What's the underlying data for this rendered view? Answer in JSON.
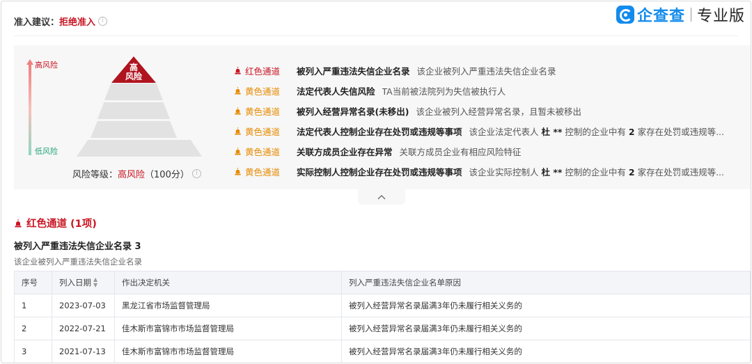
{
  "header": {
    "label": "准入建议：",
    "value": "拒绝准入"
  },
  "brand": {
    "name": "企查查",
    "edition": "专业版"
  },
  "risk_scale": {
    "high_label": "高风险",
    "low_label": "低风险"
  },
  "pyramid": {
    "top_line1": "高",
    "top_line2": "风险"
  },
  "risk_level": {
    "label": "风险等级：",
    "value": "高风险",
    "score": "（100分）"
  },
  "channels": [
    {
      "tag": "红色通道",
      "level": "red",
      "title": "被列入严重违法失信企业名录",
      "desc": "该企业被列入严重违法失信企业名录"
    },
    {
      "tag": "黄色通道",
      "level": "yellow",
      "title": "法定代表人失信风险",
      "desc": "TA当前被法院列为失信被执行人"
    },
    {
      "tag": "黄色通道",
      "level": "yellow",
      "title": "被列入经营异常名录(未移出)",
      "desc": "该企业被列入经营异常名录，且暂未被移出"
    },
    {
      "tag": "黄色通道",
      "level": "yellow",
      "title": "法定代表人控制企业存在处罚或违规等事项",
      "desc_pre": "该企业法定代表人 ",
      "desc_person": "杜 **",
      "desc_mid": " 控制的企业中有 ",
      "desc_count": "2",
      "desc_post": " 家存在处罚或违规等..."
    },
    {
      "tag": "黄色通道",
      "level": "yellow",
      "title": "关联方成员企业存在异常",
      "desc": "关联方成员企业有相应风险特征"
    },
    {
      "tag": "黄色通道",
      "level": "yellow",
      "title": "实际控制人控制企业存在处罚或违规等事项",
      "desc_pre": "该企业实际控制人 ",
      "desc_person": "杜 **",
      "desc_mid": " 控制的企业中有 ",
      "desc_count": "2",
      "desc_post": " 家存在处罚或违规等..."
    }
  ],
  "collapse_icon": "chevron-up-icon",
  "section": {
    "title": "红色通道 (1项)",
    "subtitle": "被列入严重违法失信企业名录 3",
    "description": "该企业被列入严重违法失信企业名录"
  },
  "table": {
    "headers": [
      "序号",
      "列入日期",
      "作出决定机关",
      "列入严重违法失信企业名单原因"
    ],
    "rows": [
      [
        "1",
        "2023-07-03",
        "黑龙江省市场监督管理局",
        "被列入经营异常名录届满3年仍未履行相关义务的"
      ],
      [
        "2",
        "2022-07-21",
        "佳木斯市富锦市市场监督管理局",
        "被列入经营异常名录届满3年仍未履行相关义务的"
      ],
      [
        "3",
        "2021-07-13",
        "佳木斯市富锦市市场监督管理局",
        "被列入经营异常名录届满3年仍未履行相关义务的"
      ]
    ]
  },
  "colors": {
    "red": "#c81623",
    "yellow": "#e68a00",
    "brand_blue": "#128bed"
  }
}
